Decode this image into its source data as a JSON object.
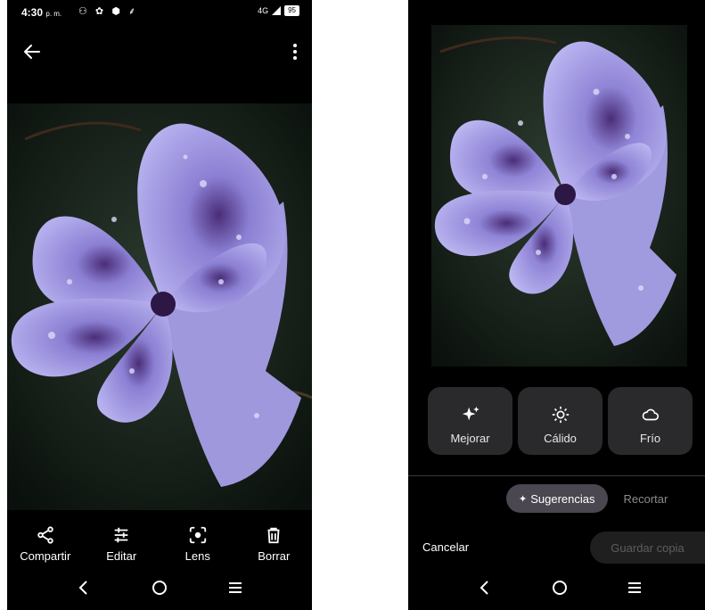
{
  "status_bar": {
    "time": "4:30",
    "ampm": "p. m.",
    "network": "4G",
    "battery": "95"
  },
  "left_screen": {
    "actions": [
      {
        "label": "Compartir",
        "icon": "share-icon"
      },
      {
        "label": "Editar",
        "icon": "sliders-icon"
      },
      {
        "label": "Lens",
        "icon": "lens-icon"
      },
      {
        "label": "Borrar",
        "icon": "trash-icon"
      }
    ]
  },
  "right_screen": {
    "filters": [
      {
        "label": "Mejorar",
        "icon": "sparkle-icon"
      },
      {
        "label": "Cálido",
        "icon": "sun-icon"
      },
      {
        "label": "Frío",
        "icon": "cloud-icon"
      }
    ],
    "tabs": {
      "suggestions": "Sugerencias",
      "crop": "Recortar"
    },
    "cancel": "Cancelar",
    "save_copy": "Guardar copia"
  },
  "colors": {
    "background": "#000000",
    "card": "#2a2a2c",
    "chip_active": "#4a4750",
    "petal": "#a29be0"
  }
}
